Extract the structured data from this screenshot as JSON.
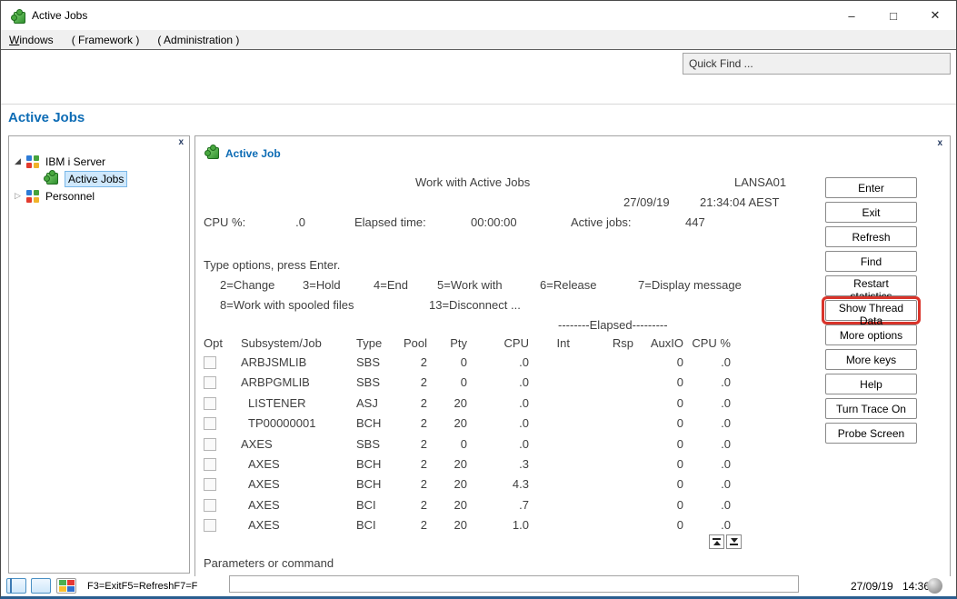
{
  "window": {
    "title": "Active Jobs",
    "controls": {
      "minimize": "–",
      "maximize": "□",
      "close": "✕"
    }
  },
  "menu": {
    "items": [
      {
        "label": "Windows",
        "underline_first": true
      },
      {
        "label": "( Framework )",
        "underline_first": false
      },
      {
        "label": "( Administration )",
        "underline_first": false
      }
    ]
  },
  "toolbar": {
    "quick_find_placeholder": "Quick Find ..."
  },
  "page_title": "Active Jobs",
  "tree": {
    "close_label": "x",
    "items": [
      {
        "label": "IBM i Server",
        "level": 0,
        "caret": "expanded",
        "icon": "pinwheel-icon",
        "selected": false
      },
      {
        "label": "Active Jobs",
        "level": 1,
        "caret": "none",
        "icon": "puzzle-icon",
        "selected": true
      },
      {
        "label": "Personnel",
        "level": 0,
        "caret": "collapsed",
        "icon": "pinwheel-icon",
        "selected": false
      }
    ]
  },
  "screen": {
    "close_label": "x",
    "tab_title": "Active Job",
    "title": "Work with Active Jobs",
    "system_name": "LANSA01",
    "date": "27/09/19",
    "time": "21:34:04 AEST",
    "cpu_label": "CPU %:",
    "cpu_value": ".0",
    "elapsed_label": "Elapsed time:",
    "elapsed_value": "00:00:00",
    "active_jobs_label": "Active jobs:",
    "active_jobs_value": "447",
    "instructions": "Type options, press Enter.",
    "options_row1": [
      "2=Change",
      "3=Hold",
      "4=End",
      "5=Work with",
      "6=Release",
      "7=Display message"
    ],
    "options_row2": [
      "8=Work with spooled files",
      "13=Disconnect ..."
    ],
    "elapsed_header": "--------Elapsed---------"
  },
  "table": {
    "headers": [
      "Opt",
      "Subsystem/Job",
      "Type",
      "Pool",
      "Pty",
      "CPU",
      "Int",
      "Rsp",
      "AuxIO",
      "CPU %"
    ],
    "rows": [
      {
        "indent": false,
        "cells": [
          "ARBJSMLIB",
          "SBS",
          "2",
          "0",
          ".0",
          "",
          "",
          "0",
          ".0"
        ]
      },
      {
        "indent": false,
        "cells": [
          "ARBPGMLIB",
          "SBS",
          "2",
          "0",
          ".0",
          "",
          "",
          "0",
          ".0"
        ]
      },
      {
        "indent": true,
        "cells": [
          "LISTENER",
          "ASJ",
          "2",
          "20",
          ".0",
          "",
          "",
          "0",
          ".0"
        ]
      },
      {
        "indent": true,
        "cells": [
          "TP00000001",
          "BCH",
          "2",
          "20",
          ".0",
          "",
          "",
          "0",
          ".0"
        ]
      },
      {
        "indent": false,
        "cells": [
          "AXES",
          "SBS",
          "2",
          "0",
          ".0",
          "",
          "",
          "0",
          ".0"
        ]
      },
      {
        "indent": true,
        "cells": [
          "AXES",
          "BCH",
          "2",
          "20",
          ".3",
          "",
          "",
          "0",
          ".0"
        ]
      },
      {
        "indent": true,
        "cells": [
          "AXES",
          "BCH",
          "2",
          "20",
          "4.3",
          "",
          "",
          "0",
          ".0"
        ]
      },
      {
        "indent": true,
        "cells": [
          "AXES",
          "BCI",
          "2",
          "20",
          ".7",
          "",
          "",
          "0",
          ".0"
        ]
      },
      {
        "indent": true,
        "cells": [
          "AXES",
          "BCI",
          "2",
          "20",
          "1.0",
          "",
          "",
          "0",
          ".0"
        ]
      }
    ]
  },
  "action_buttons": [
    {
      "label": "Enter"
    },
    {
      "label": "Exit"
    },
    {
      "label": "Refresh"
    },
    {
      "label": "Find"
    },
    {
      "label": "Restart statistics"
    },
    {
      "label": "Show Thread Data",
      "highlighted": true
    },
    {
      "label": "More options"
    },
    {
      "label": "More keys"
    },
    {
      "label": "Help"
    },
    {
      "label": "Turn Trace On"
    },
    {
      "label": "Probe Screen"
    }
  ],
  "command": {
    "label": "Parameters or command",
    "prompt": "===>",
    "value": ""
  },
  "statusbar": {
    "fkeys": "F3=ExitF5=RefreshF7=F",
    "date": "27/09/19",
    "time": "14:36"
  },
  "colors": {
    "accent_blue": "#0d6cb5",
    "highlight_red": "#d9342b",
    "selection_blue": "#cfe8fc",
    "screen_text": "#3f3f3f"
  }
}
